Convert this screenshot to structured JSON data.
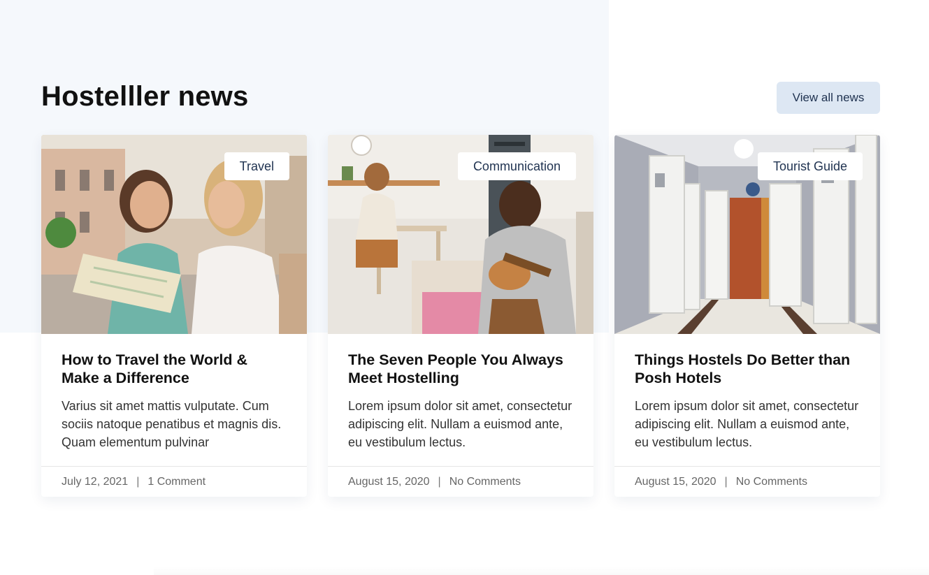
{
  "header": {
    "title": "Hostelller news",
    "view_all_label": "View all news"
  },
  "cards": [
    {
      "tag": "Travel",
      "title": "How to Travel the World & Make a Difference",
      "excerpt": "Varius sit amet mattis vulputate. Cum sociis natoque penatibus et magnis dis. Quam elementum pulvinar",
      "date": "July 12, 2021",
      "comments": "1 Comment",
      "image": "two-women-with-map-photo"
    },
    {
      "tag": "Communication",
      "title": "The Seven People You Always Meet Hostelling",
      "excerpt": "Lorem ipsum dolor sit amet, consectetur adipiscing elit. Nullam a euismod ante, eu vestibulum lectus.",
      "date": "August 15, 2020",
      "comments": "No Comments",
      "image": "man-playing-guitar-photo"
    },
    {
      "tag": "Tourist Guide",
      "title": "Things Hostels Do Better than Posh Hotels",
      "excerpt": "Lorem ipsum dolor sit amet, consectetur adipiscing elit. Nullam a euismod ante, eu vestibulum lectus.",
      "date": "August 15, 2020",
      "comments": "No Comments",
      "image": "hostel-hallway-photo"
    }
  ],
  "meta_separator": "|",
  "colors": {
    "panel_bg": "#f5f8fc",
    "button_bg": "#dde7f3",
    "button_text": "#1f3250",
    "heading": "#111111"
  }
}
